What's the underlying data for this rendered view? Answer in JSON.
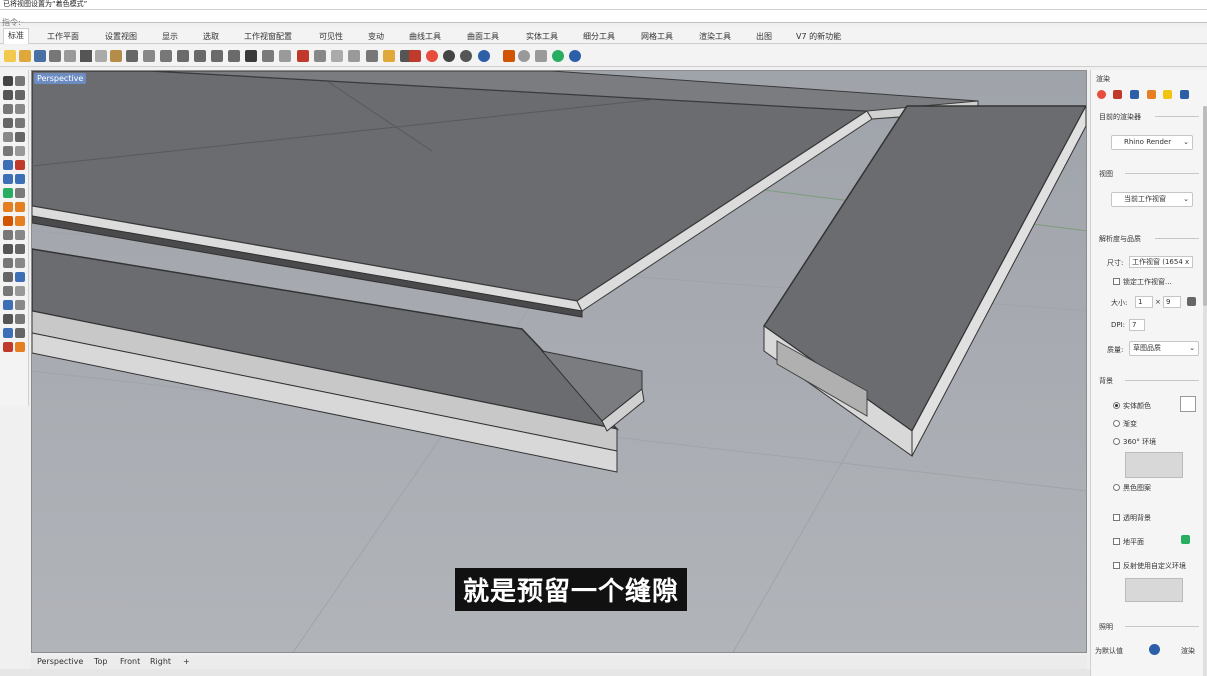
{
  "command": {
    "history": "已将视图设置为“着色模式”",
    "prompt": "指令:"
  },
  "tabs": [
    {
      "label": "标准"
    },
    {
      "label": "工作平面"
    },
    {
      "label": "设置视图"
    },
    {
      "label": "显示"
    },
    {
      "label": "选取"
    },
    {
      "label": "工作视窗配置"
    },
    {
      "label": "可见性"
    },
    {
      "label": "变动"
    },
    {
      "label": "曲线工具"
    },
    {
      "label": "曲面工具"
    },
    {
      "label": "实体工具"
    },
    {
      "label": "细分工具"
    },
    {
      "label": "网格工具"
    },
    {
      "label": "渲染工具"
    },
    {
      "label": "出图"
    },
    {
      "label": "V7 的新功能"
    }
  ],
  "viewport": {
    "label": "Perspective",
    "caption": "就是预留一个缝隙"
  },
  "bottom_tabs": [
    "Perspective",
    "Top",
    "Front",
    "Right",
    "+"
  ],
  "right_panel": {
    "title": "渲染",
    "current_renderer_title": "目前的渲染器",
    "renderer": "Rhino Render",
    "view_title": "视图",
    "view_value": "当前工作视窗",
    "resolution_title": "解析度与品质",
    "size_label": "尺寸:",
    "size_value": "工作视窗 (1654 x",
    "lock_viewport_label": "锁定工作视窗...",
    "dims_label": "大小:",
    "width_value": "1",
    "height_value": "9",
    "dpi_label": "DPI:",
    "dpi_value": "7",
    "quality_label": "质量:",
    "quality_value": "草图品质",
    "background_title": "背景",
    "bg_solid": "实体颜色",
    "bg_gradient": "渐变",
    "bg_360": "360° 环境",
    "bg_wallpaper": "黑色图案",
    "transparent_bg": "透明背景",
    "ground_plane": "地平面",
    "custom_env_reflect": "反射使用自定义环境",
    "lighting_title": "照明",
    "bottom_default": "为默认值",
    "bottom_render": "渲染"
  }
}
